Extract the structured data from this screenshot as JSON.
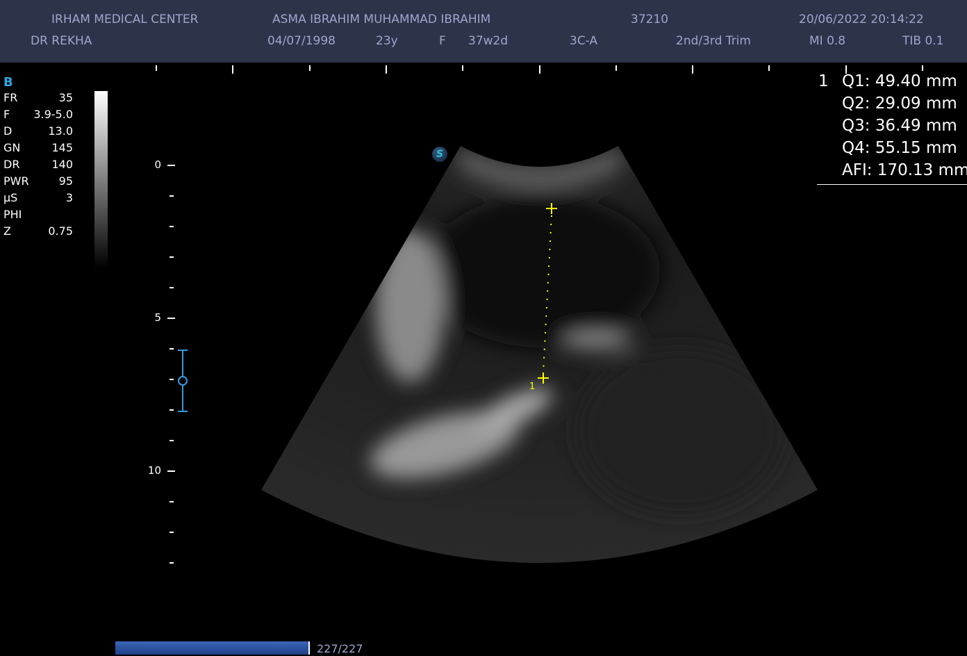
{
  "header": {
    "institution": "IRHAM MEDICAL CENTER",
    "patient_name": "ASMA IBRAHIM MUHAMMAD IBRAHIM",
    "patient_id": "37210",
    "datetime": "20/06/2022 20:14:22",
    "doctor": "DR REKHA",
    "dob": "04/07/1998",
    "age": "23y",
    "sex": "F",
    "gestational_age": "37w2d",
    "probe": "3C-A",
    "preset": "2nd/3rd Trim",
    "mi": "MI 0.8",
    "tib": "TIB 0.1"
  },
  "params": {
    "mode": "B",
    "rows": [
      {
        "label": "FR",
        "value": "35"
      },
      {
        "label": "F",
        "value": "3.9-5.0"
      },
      {
        "label": "D",
        "value": "13.0"
      },
      {
        "label": "GN",
        "value": "145"
      },
      {
        "label": "DR",
        "value": "140"
      },
      {
        "label": "PWR",
        "value": "95"
      },
      {
        "label": "µS",
        "value": "3"
      },
      {
        "label": "PHI",
        "value": ""
      },
      {
        "label": "Z",
        "value": "0.75"
      }
    ]
  },
  "depth_scale": {
    "labels": [
      "0",
      "5",
      "10"
    ]
  },
  "measurements": {
    "index": "1",
    "rows": [
      {
        "label": "Q1: 49.40  mm"
      },
      {
        "label": "Q2: 29.09  mm"
      },
      {
        "label": "Q3: 36.49  mm"
      },
      {
        "label": "Q4: 55.15  mm"
      },
      {
        "label": "AFI: 170.13 mm"
      }
    ]
  },
  "caliper": {
    "label": "1",
    "color": "#ffff00"
  },
  "sono_icon": "S",
  "cine": {
    "frame": "227/227",
    "progress": 1.0
  }
}
